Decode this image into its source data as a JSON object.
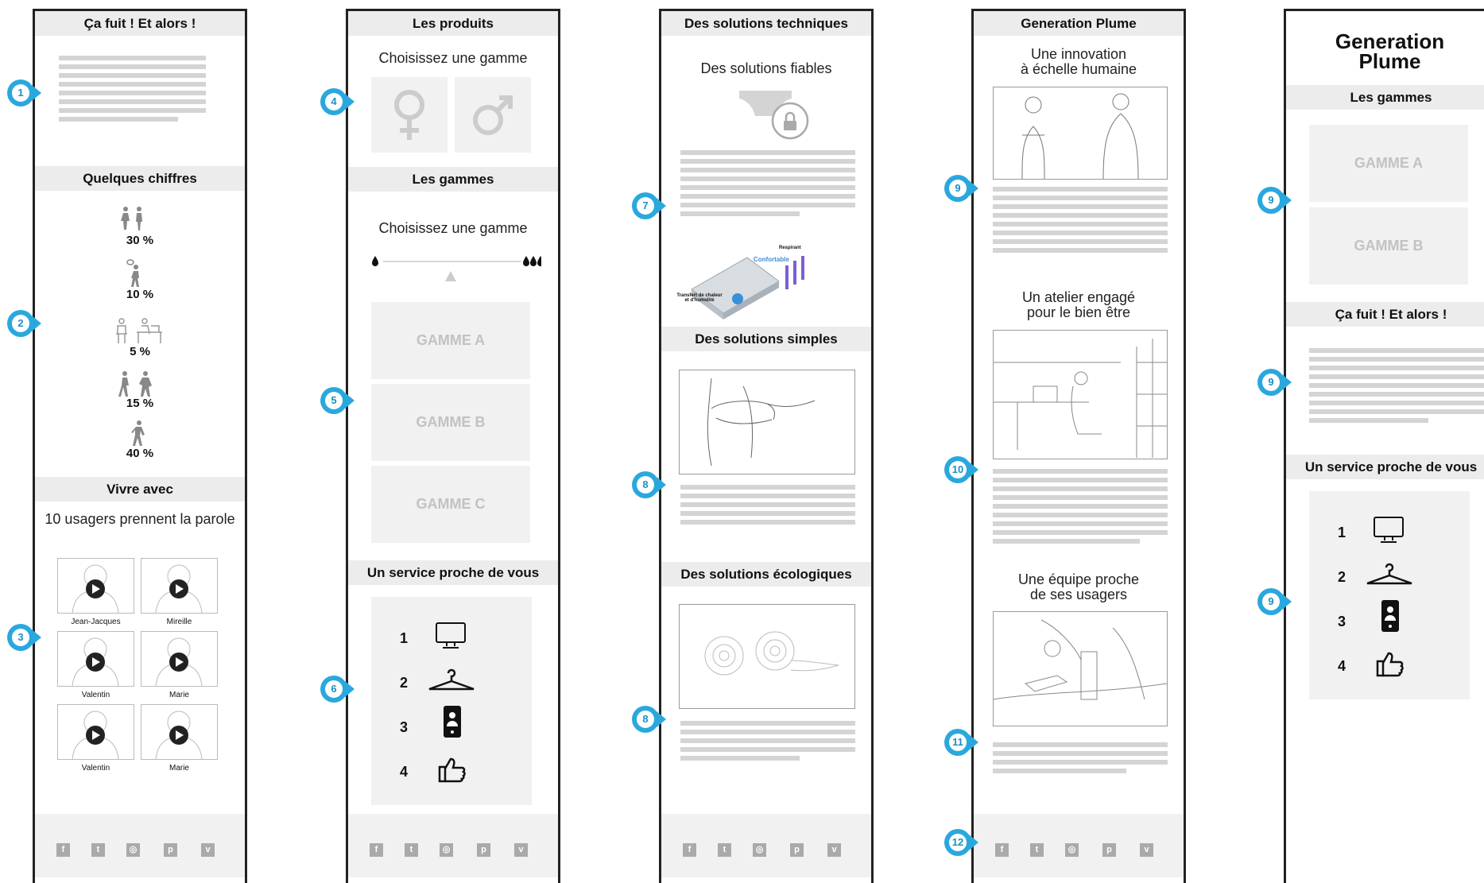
{
  "col1": {
    "h_alors": "Ça fuit ! Et alors !",
    "h_chiffres": "Quelques chiffres",
    "stats": [
      "30 %",
      "10 %",
      "5 %",
      "15 %",
      "40 %"
    ],
    "h_vivre": "Vivre avec",
    "vivre_sub": "10 usagers prennent la parole",
    "users": [
      "Jean-Jacques",
      "Mireille",
      "Valentin",
      "Marie",
      "Valentin",
      "Marie"
    ]
  },
  "col2": {
    "h_produits": "Les produits",
    "choose1": "Choisissez une gamme",
    "h_gammes": "Les gammes",
    "choose2": "Choisissez une gamme",
    "gammes": [
      "GAMME A",
      "GAMME B",
      "GAMME C"
    ],
    "h_service": "Un service proche de vous",
    "service_nums": [
      "1",
      "2",
      "3",
      "4"
    ]
  },
  "col3": {
    "h_tech": "Des solutions techniques",
    "fiables": "Des solutions fiables",
    "fabric_labels": [
      "Respirant",
      "Confortable",
      "Transfert de chaleur et d'humidité"
    ],
    "h_simples": "Des solutions simples",
    "h_eco": "Des solutions écologiques"
  },
  "col4": {
    "h_plume": "Generation Plume",
    "innov1": "Une innovation",
    "innov2": "à échelle humaine",
    "atelier1": "Un atelier engagé",
    "atelier2": "pour le bien être",
    "equipe1": "Une équipe proche",
    "equipe2": "de ses usagers"
  },
  "col5": {
    "title1": "Generation",
    "title2": "Plume",
    "h_gammes": "Les gammes",
    "gammes": [
      "GAMME A",
      "GAMME B"
    ],
    "h_alors": "Ça fuit ! Et alors !",
    "h_service": "Un service proche de vous",
    "service_nums": [
      "1",
      "2",
      "3",
      "4"
    ]
  },
  "social": [
    "f",
    "t",
    "◎",
    "p",
    "v"
  ],
  "badges": {
    "b1": "1",
    "b2": "2",
    "b3": "3",
    "b4": "4",
    "b5": "5",
    "b6": "6",
    "b7": "7",
    "b8a": "8",
    "b8b": "8",
    "b9a": "9",
    "b9b": "9",
    "b9c": "9",
    "b9d": "9",
    "b10": "10",
    "b11": "11",
    "b12": "12"
  },
  "colors": {
    "accent": "#2aa8de",
    "header_bg": "#ececec",
    "placeholder": "#d4d4d4"
  }
}
